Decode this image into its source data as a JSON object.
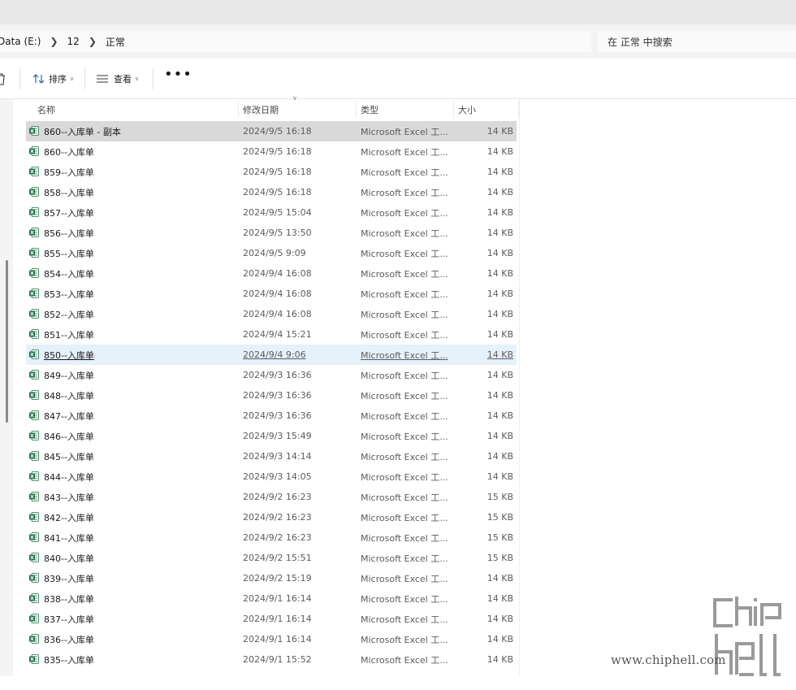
{
  "breadcrumb": {
    "items": [
      "Data (E:)",
      "12",
      "正常"
    ]
  },
  "search": {
    "placeholder": "在 正常 中搜索"
  },
  "toolbar": {
    "sort_label": "排序",
    "view_label": "查看",
    "more_label": "•••"
  },
  "columns": {
    "name": "名称",
    "date": "修改日期",
    "type": "类型",
    "size": "大小"
  },
  "files": [
    {
      "name": "860--入库单 - 副本",
      "date": "2024/9/5 16:18",
      "type": "Microsoft Excel 工...",
      "size": "14 KB",
      "state": "selected"
    },
    {
      "name": "860--入库单",
      "date": "2024/9/5 16:18",
      "type": "Microsoft Excel 工...",
      "size": "14 KB"
    },
    {
      "name": "859--入库单",
      "date": "2024/9/5 16:18",
      "type": "Microsoft Excel 工...",
      "size": "14 KB"
    },
    {
      "name": "858--入库单",
      "date": "2024/9/5 16:18",
      "type": "Microsoft Excel 工...",
      "size": "14 KB"
    },
    {
      "name": "857--入库单",
      "date": "2024/9/5 15:04",
      "type": "Microsoft Excel 工...",
      "size": "14 KB"
    },
    {
      "name": "856--入库单",
      "date": "2024/9/5 13:50",
      "type": "Microsoft Excel 工...",
      "size": "14 KB"
    },
    {
      "name": "855--入库单",
      "date": "2024/9/5 9:09",
      "type": "Microsoft Excel 工...",
      "size": "14 KB"
    },
    {
      "name": "854--入库单",
      "date": "2024/9/4 16:08",
      "type": "Microsoft Excel 工...",
      "size": "14 KB"
    },
    {
      "name": "853--入库单",
      "date": "2024/9/4 16:08",
      "type": "Microsoft Excel 工...",
      "size": "14 KB"
    },
    {
      "name": "852--入库单",
      "date": "2024/9/4 16:08",
      "type": "Microsoft Excel 工...",
      "size": "14 KB"
    },
    {
      "name": "851--入库单",
      "date": "2024/9/4 15:21",
      "type": "Microsoft Excel 工...",
      "size": "14 KB"
    },
    {
      "name": "850--入库单",
      "date": "2024/9/4 9:06",
      "type": "Microsoft Excel 工...",
      "size": "14 KB",
      "state": "hover"
    },
    {
      "name": "849--入库单",
      "date": "2024/9/3 16:36",
      "type": "Microsoft Excel 工...",
      "size": "14 KB"
    },
    {
      "name": "848--入库单",
      "date": "2024/9/3 16:36",
      "type": "Microsoft Excel 工...",
      "size": "14 KB"
    },
    {
      "name": "847--入库单",
      "date": "2024/9/3 16:36",
      "type": "Microsoft Excel 工...",
      "size": "14 KB"
    },
    {
      "name": "846--入库单",
      "date": "2024/9/3 15:49",
      "type": "Microsoft Excel 工...",
      "size": "14 KB"
    },
    {
      "name": "845--入库单",
      "date": "2024/9/3 14:14",
      "type": "Microsoft Excel 工...",
      "size": "14 KB"
    },
    {
      "name": "844--入库单",
      "date": "2024/9/3 14:05",
      "type": "Microsoft Excel 工...",
      "size": "14 KB"
    },
    {
      "name": "843--入库单",
      "date": "2024/9/2 16:23",
      "type": "Microsoft Excel 工...",
      "size": "15 KB"
    },
    {
      "name": "842--入库单",
      "date": "2024/9/2 16:23",
      "type": "Microsoft Excel 工...",
      "size": "15 KB"
    },
    {
      "name": "841--入库单",
      "date": "2024/9/2 16:23",
      "type": "Microsoft Excel 工...",
      "size": "15 KB"
    },
    {
      "name": "840--入库单",
      "date": "2024/9/2 15:51",
      "type": "Microsoft Excel 工...",
      "size": "15 KB"
    },
    {
      "name": "839--入库单",
      "date": "2024/9/2 15:19",
      "type": "Microsoft Excel 工...",
      "size": "14 KB"
    },
    {
      "name": "838--入库单",
      "date": "2024/9/1 16:14",
      "type": "Microsoft Excel 工...",
      "size": "14 KB"
    },
    {
      "name": "837--入库单",
      "date": "2024/9/1 16:14",
      "type": "Microsoft Excel 工...",
      "size": "14 KB"
    },
    {
      "name": "836--入库单",
      "date": "2024/9/1 16:14",
      "type": "Microsoft Excel 工...",
      "size": "14 KB"
    },
    {
      "name": "835--入库单",
      "date": "2024/9/1 15:52",
      "type": "Microsoft Excel 工...",
      "size": "14 KB"
    }
  ],
  "icons": {
    "file": "excel-file-icon",
    "sort": "sort-arrows-icon",
    "view": "view-list-icon",
    "delete": "trash-icon"
  },
  "colors": {
    "excel_green": "#1d7044",
    "selected_row": "#d9d9d9",
    "hover_row": "#e5f1fb"
  },
  "watermark": {
    "text": "www.chiphell.com"
  }
}
